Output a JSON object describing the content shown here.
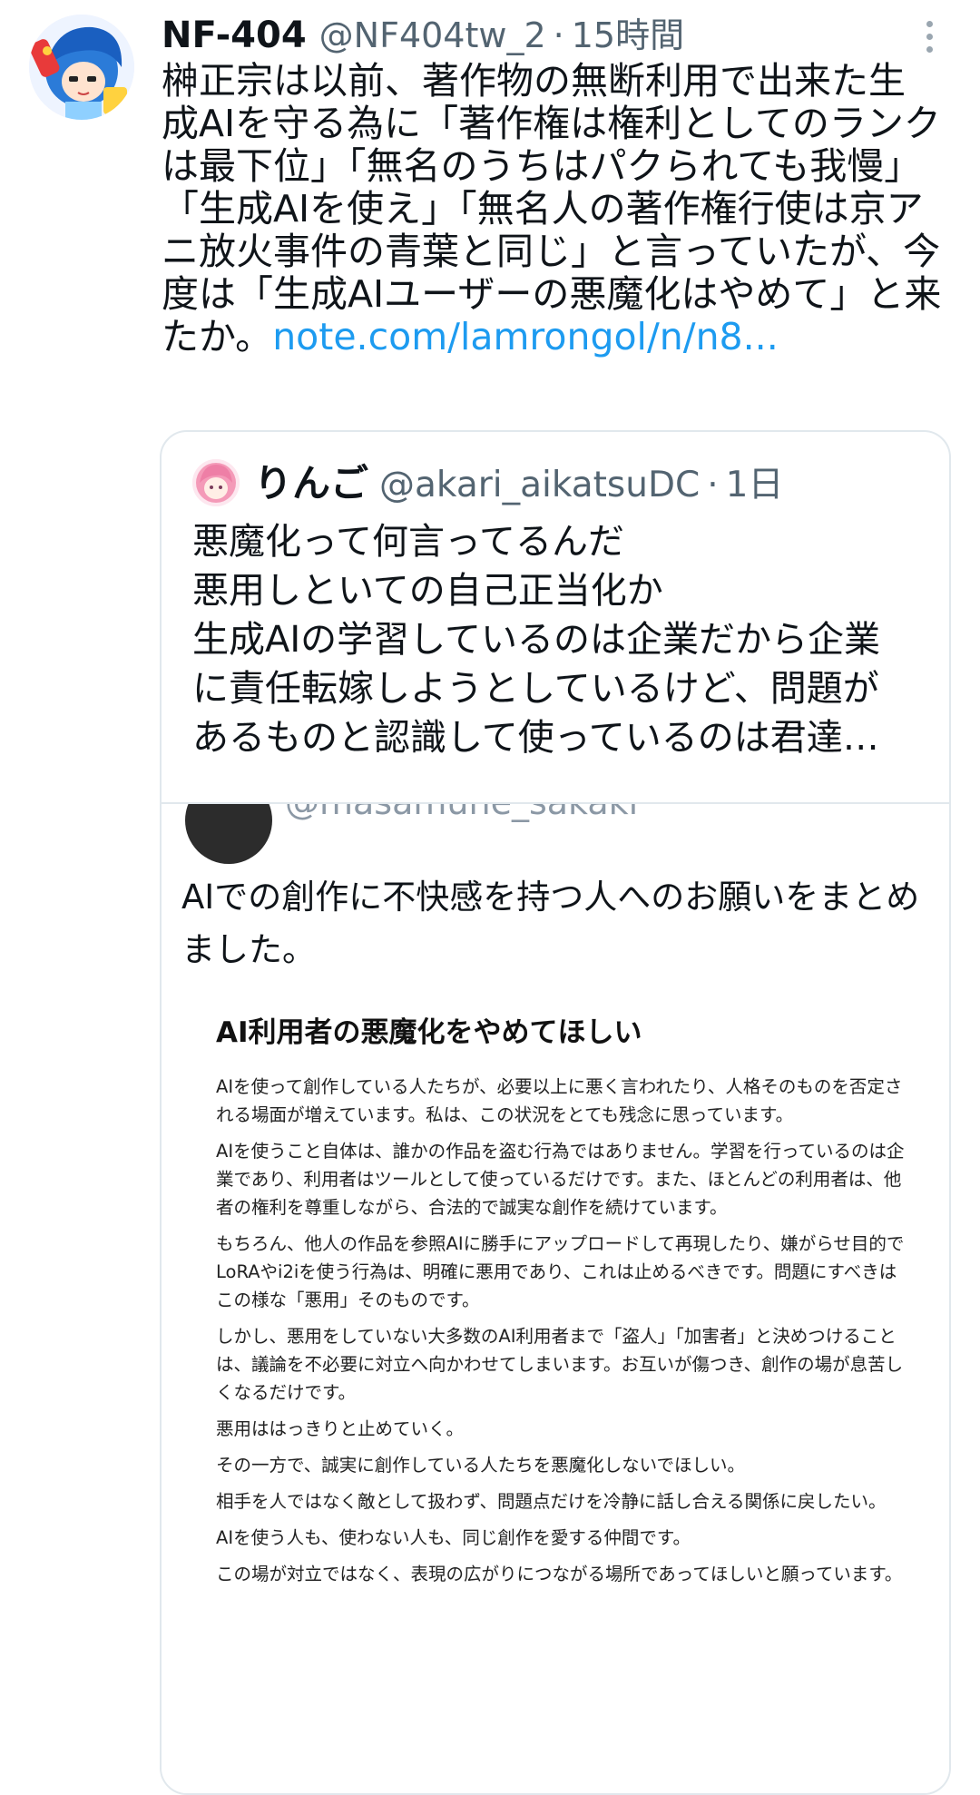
{
  "tweet": {
    "display_name": "NF-404",
    "handle": "@NF404tw_2",
    "separator": "·",
    "time": "15時間",
    "text": "榊正宗は以前、著作物の無断利用で出来た生成AIを守る為に「著作権は権利としてのランクは最下位」「無名のうちはパクられても我慢」「生成AIを使え」「無名人の著作権行使は京アニ放火事件の青葉と同じ」と言っていたが、今度は「生成AIユーザーの悪魔化はやめて」と来たか。",
    "link": "note.com/lamrongol/n/n8..."
  },
  "quote": {
    "display_name": "りんご",
    "handle": "@akari_aikatsuDC",
    "separator": "·",
    "time": "1日",
    "lines": [
      "悪魔化って何言ってるんだ",
      "悪用しといての自己正当化か",
      "生成AIの学習しているのは企業だから企業",
      "に責任転嫁しようとしているけど、問題が",
      "あるものと認識して使っているのは君達…"
    ],
    "inner": {
      "handle_partial": "@masamune_sakaki",
      "text": "AIでの創作に不快感を持つ人へのお願いをまとめました。",
      "doc_title": "AI利用者の悪魔化をやめてほしい",
      "doc_paragraphs": [
        "AIを使って創作している人たちが、必要以上に悪く言われたり、人格そのものを否定される場面が増えています。私は、この状況をとても残念に思っています。",
        "AIを使うこと自体は、誰かの作品を盗む行為ではありません。学習を行っているのは企業であり、利用者はツールとして使っているだけです。また、ほとんどの利用者は、他者の権利を尊重しながら、合法的で誠実な創作を続けています。",
        "もちろん、他人の作品を参照AIに勝手にアップロードして再現したり、嫌がらせ目的でLoRAやi2iを使う行為は、明確に悪用であり、これは止めるべきです。問題にすべきはこの様な「悪用」そのものです。",
        "しかし、悪用をしていない大多数のAI利用者まで「盗人」「加害者」と決めつけることは、議論を不必要に対立へ向かわせてしまいます。お互いが傷つき、創作の場が息苦しくなるだけです。",
        "悪用ははっきりと止めていく。",
        "その一方で、誠実に創作している人たちを悪魔化しないでほしい。",
        "相手を人ではなく敵として扱わず、問題点だけを冷静に話し合える関係に戻したい。",
        "AIを使う人も、使わない人も、同じ創作を愛する仲間です。",
        "この場が対立ではなく、表現の広がりにつながる場所であってほしいと願っています。"
      ]
    }
  }
}
